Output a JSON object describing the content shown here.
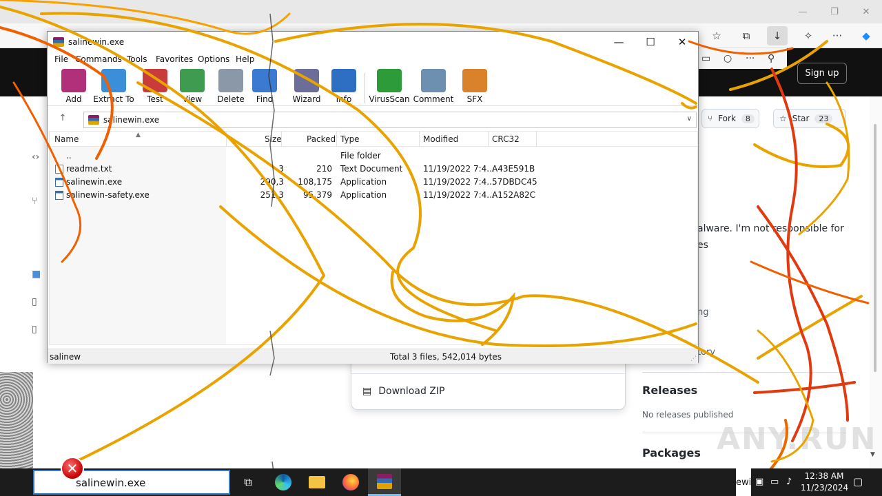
{
  "edge": {
    "win_controls": [
      "—",
      "❐",
      "✕"
    ],
    "toolbar_icons": [
      "favorite-star-icon",
      "collections-icon",
      "download-icon",
      "extensions-icon",
      "more-icon",
      "copilot-icon"
    ],
    "more_symbol": "···"
  },
  "github": {
    "signup_label": "Sign up",
    "fork_label": "Fork",
    "fork_count": "8",
    "star_label": "Star",
    "star_count": "23",
    "desc_line1": "alware. I'm not responsible for",
    "desc_line2": "es",
    "sidebar_fragment1": "ng",
    "sidebar_fragment2": "tory",
    "releases_heading": "Releases",
    "releases_text": "No releases published",
    "packages_heading": "Packages",
    "download_zip_label": "Download ZIP",
    "watermark": "ANY.RUN"
  },
  "winrar": {
    "title": "salinewin.exe",
    "menu": [
      "Commands",
      "Tools",
      "Favorites",
      "Options",
      "Help"
    ],
    "tools": [
      {
        "label": "Add",
        "color": "#b0307a"
      },
      {
        "label": "Extract To",
        "color": "#3b8fd9"
      },
      {
        "label": "Test",
        "color": "#c93c3c"
      },
      {
        "label": "View",
        "color": "#3e9b4f"
      },
      {
        "label": "Delete",
        "color": "#8a98a8"
      },
      {
        "label": "Find",
        "color": "#3a7ad0"
      },
      {
        "label": "Wizard",
        "color": "#6d6d9a"
      },
      {
        "label": "Info",
        "color": "#2f6fc2"
      },
      {
        "label": "VirusScan",
        "color": "#2e9b3a"
      },
      {
        "label": "Comment",
        "color": "#6d8fb0"
      },
      {
        "label": "SFX",
        "color": "#d9822b"
      }
    ],
    "path": "salinewin.exe",
    "columns": [
      "Name",
      "Size",
      "Packed",
      "Type",
      "Modified",
      "CRC32"
    ],
    "rows": [
      {
        "name": "..",
        "size": "",
        "packed": "",
        "type": "File folder",
        "modified": "",
        "crc": "",
        "kind": "folder"
      },
      {
        "name": "readme.txt",
        "size": "3",
        "packed": "210",
        "type": "Text Document",
        "modified": "11/19/2022 7:4...",
        "crc": "A43E591B",
        "kind": "doc"
      },
      {
        "name": "salinewin.exe",
        "size": "290,3",
        "packed": "108,175",
        "type": "Application",
        "modified": "11/19/2022 7:4...",
        "crc": "57DBDC45",
        "kind": "app"
      },
      {
        "name": "salinewin-safety.exe",
        "size": "251,3",
        "packed": "95,379",
        "type": "Application",
        "modified": "11/19/2022 7:4...",
        "crc": "A152A82C",
        "kind": "app"
      }
    ],
    "status_left": "salinew",
    "status_right": "Total 3 files, 542,014 bytes"
  },
  "taskbar": {
    "search_text": "salinewin.exe",
    "tray_label": "ewi",
    "time": "12:38 AM",
    "date": "11/23/2024"
  },
  "colors": {
    "scribble_orange": "#e8a300",
    "scribble_red": "#e03a10",
    "taskbar_bg": "#1c1c1c",
    "accent_blue": "#3478c6"
  }
}
